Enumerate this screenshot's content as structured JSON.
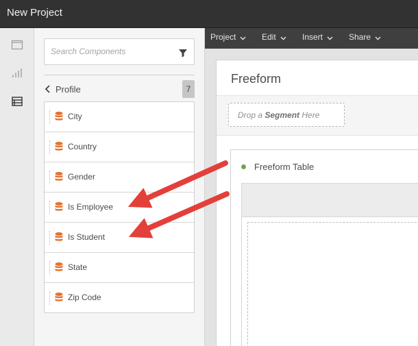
{
  "app": {
    "title": "New Project"
  },
  "rail": {
    "icons": [
      "panels-icon",
      "visualizations-icon",
      "components-icon"
    ]
  },
  "components": {
    "search_placeholder": "Search Components",
    "breadcrumb": {
      "label": "Profile",
      "count": "7"
    },
    "items": [
      {
        "label": "City"
      },
      {
        "label": "Country"
      },
      {
        "label": "Gender"
      },
      {
        "label": "Is Employee"
      },
      {
        "label": "Is Student"
      },
      {
        "label": "State"
      },
      {
        "label": "Zip Code"
      }
    ]
  },
  "menu": {
    "project": "Project",
    "edit": "Edit",
    "insert": "Insert",
    "share": "Share"
  },
  "panel": {
    "title": "Freeform",
    "drop_segment_prefix": "Drop a ",
    "drop_segment_bold": "Segment",
    "drop_segment_suffix": " Here",
    "table_title": "Freeform Table"
  },
  "colors": {
    "accent_orange": "#e6722e",
    "arrow_red": "#e3403b",
    "status_green": "#6aa84f"
  }
}
